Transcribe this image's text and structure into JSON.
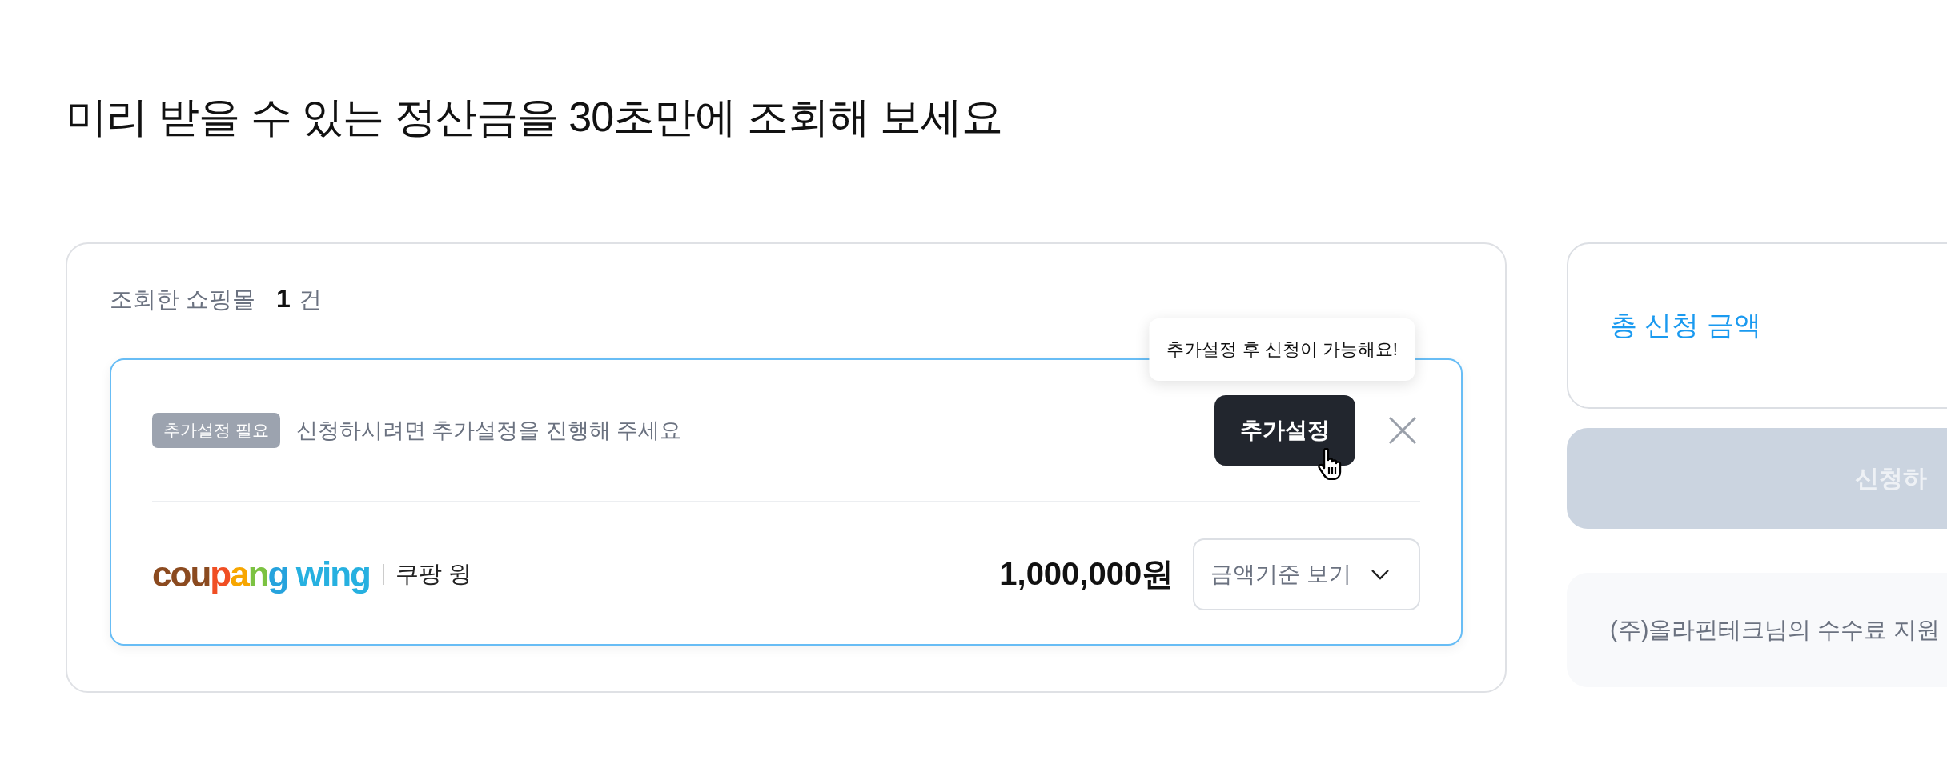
{
  "page_title": "미리 받을 수 있는 정산금을 30초만에 조회해 보세요",
  "summary": {
    "label": "조회한 쇼핑몰",
    "count": "1",
    "unit": "건"
  },
  "malls": [
    {
      "badge": "추가설정 필요",
      "message": "신청하시려면 추가설정을 진행해 주세요",
      "action": "추가설정",
      "tooltip": "추가설정 후 신청이 가능해요!",
      "logo": [
        "coupang",
        "wing"
      ],
      "name": "쿠팡 윙",
      "amount": "1,000,000원",
      "view_select": "금액기준 보기"
    }
  ],
  "total": {
    "label": "총 신청 금액"
  },
  "apply_button": {
    "label": "신청하",
    "disabled": true
  },
  "notice": "(주)올라핀테크님의 수수료 지원"
}
